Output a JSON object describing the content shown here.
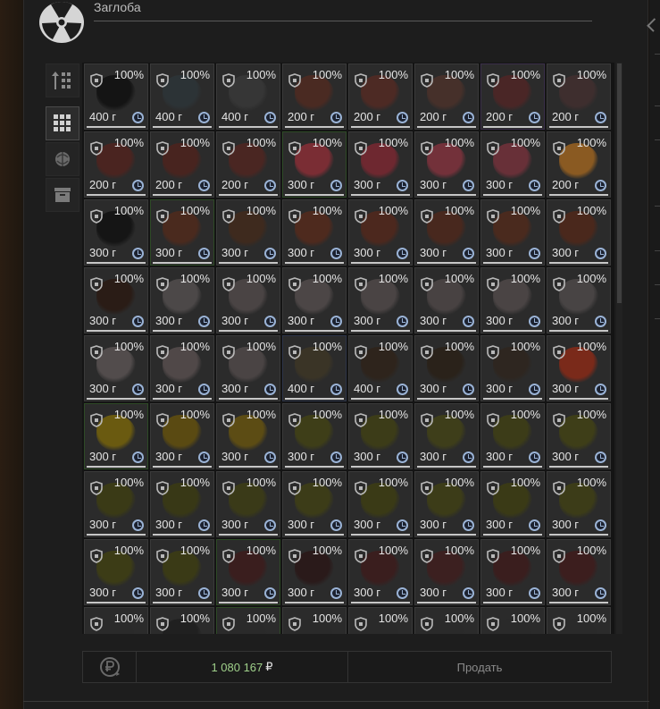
{
  "header": {
    "title": "Заглоба",
    "icon": "radiation-icon"
  },
  "sidebar": {
    "items": [
      {
        "name": "sort-icon",
        "active": false
      },
      {
        "name": "grid-view-icon",
        "active": true
      },
      {
        "name": "artifact-icon",
        "active": false
      },
      {
        "name": "archive-icon",
        "active": false
      }
    ]
  },
  "grid": {
    "cells": [
      {
        "percent": "100%",
        "weight": "400 г",
        "art": "#141414",
        "border": ""
      },
      {
        "percent": "100%",
        "weight": "400 г",
        "art": "#2c3336",
        "border": ""
      },
      {
        "percent": "100%",
        "weight": "400 г",
        "art": "#363636",
        "border": ""
      },
      {
        "percent": "100%",
        "weight": "200 г",
        "art": "#4a2a22",
        "border": ""
      },
      {
        "percent": "100%",
        "weight": "200 г",
        "art": "#4d2a24",
        "border": ""
      },
      {
        "percent": "100%",
        "weight": "200 г",
        "art": "#46302a",
        "border": ""
      },
      {
        "percent": "100%",
        "weight": "200 г",
        "art": "#4a2626",
        "border": "c-purple"
      },
      {
        "percent": "100%",
        "weight": "200 г",
        "art": "#3e2e2e",
        "border": ""
      },
      {
        "percent": "100%",
        "weight": "200 г",
        "art": "#4a2420",
        "border": ""
      },
      {
        "percent": "100%",
        "weight": "200 г",
        "art": "#48241f",
        "border": ""
      },
      {
        "percent": "100%",
        "weight": "200 г",
        "art": "#4a2622",
        "border": ""
      },
      {
        "percent": "100%",
        "weight": "300 г",
        "art": "#7a2d34",
        "border": "c-green"
      },
      {
        "percent": "100%",
        "weight": "300 г",
        "art": "#6e2830",
        "border": ""
      },
      {
        "percent": "100%",
        "weight": "300 г",
        "art": "#73313a",
        "border": ""
      },
      {
        "percent": "100%",
        "weight": "300 г",
        "art": "#683038",
        "border": ""
      },
      {
        "percent": "100%",
        "weight": "200 г",
        "art": "#8a5a22",
        "border": ""
      },
      {
        "percent": "100%",
        "weight": "300 г",
        "art": "#151515",
        "border": ""
      },
      {
        "percent": "100%",
        "weight": "300 г",
        "art": "#4a2a1e",
        "border": "c-green"
      },
      {
        "percent": "100%",
        "weight": "300 г",
        "art": "#3e2a1e",
        "border": ""
      },
      {
        "percent": "100%",
        "weight": "300 г",
        "art": "#4e2a1e",
        "border": ""
      },
      {
        "percent": "100%",
        "weight": "300 г",
        "art": "#4c281e",
        "border": ""
      },
      {
        "percent": "100%",
        "weight": "300 г",
        "art": "#48281e",
        "border": ""
      },
      {
        "percent": "100%",
        "weight": "300 г",
        "art": "#4a2a1e",
        "border": ""
      },
      {
        "percent": "100%",
        "weight": "300 г",
        "art": "#4a281c",
        "border": ""
      },
      {
        "percent": "100%",
        "weight": "300 г",
        "art": "#2a1c16",
        "border": ""
      },
      {
        "percent": "100%",
        "weight": "300 г",
        "art": "#4c4848",
        "border": ""
      },
      {
        "percent": "100%",
        "weight": "300 г",
        "art": "#4a4444",
        "border": ""
      },
      {
        "percent": "100%",
        "weight": "300 г",
        "art": "#4c4646",
        "border": ""
      },
      {
        "percent": "100%",
        "weight": "300 г",
        "art": "#4a4444",
        "border": ""
      },
      {
        "percent": "100%",
        "weight": "300 г",
        "art": "#484242",
        "border": ""
      },
      {
        "percent": "100%",
        "weight": "300 г",
        "art": "#4a4444",
        "border": ""
      },
      {
        "percent": "100%",
        "weight": "300 г",
        "art": "#484444",
        "border": ""
      },
      {
        "percent": "100%",
        "weight": "300 г",
        "art": "#524c4c",
        "border": ""
      },
      {
        "percent": "100%",
        "weight": "300 г",
        "art": "#504848",
        "border": ""
      },
      {
        "percent": "100%",
        "weight": "300 г",
        "art": "#4a4444",
        "border": ""
      },
      {
        "percent": "100%",
        "weight": "400 г",
        "art": "#3a3426",
        "border": "c-blue"
      },
      {
        "percent": "100%",
        "weight": "400 г",
        "art": "#2e241c",
        "border": ""
      },
      {
        "percent": "100%",
        "weight": "300 г",
        "art": "#2a221a",
        "border": ""
      },
      {
        "percent": "100%",
        "weight": "300 г",
        "art": "#2e2620",
        "border": ""
      },
      {
        "percent": "100%",
        "weight": "300 г",
        "art": "#7a2a1a",
        "border": ""
      },
      {
        "percent": "100%",
        "weight": "300 г",
        "art": "#6a5a10",
        "border": "c-green"
      },
      {
        "percent": "100%",
        "weight": "300 г",
        "art": "#5a4a12",
        "border": ""
      },
      {
        "percent": "100%",
        "weight": "300 г",
        "art": "#5c4c14",
        "border": ""
      },
      {
        "percent": "100%",
        "weight": "300 г",
        "art": "#3e3e18",
        "border": ""
      },
      {
        "percent": "100%",
        "weight": "300 г",
        "art": "#3c3c18",
        "border": ""
      },
      {
        "percent": "100%",
        "weight": "300 г",
        "art": "#3e3e1a",
        "border": ""
      },
      {
        "percent": "100%",
        "weight": "300 г",
        "art": "#3c3c18",
        "border": ""
      },
      {
        "percent": "100%",
        "weight": "300 г",
        "art": "#3e3e18",
        "border": ""
      },
      {
        "percent": "100%",
        "weight": "300 г",
        "art": "#3a3a16",
        "border": ""
      },
      {
        "percent": "100%",
        "weight": "300 г",
        "art": "#383816",
        "border": ""
      },
      {
        "percent": "100%",
        "weight": "300 г",
        "art": "#3a3a18",
        "border": ""
      },
      {
        "percent": "100%",
        "weight": "300 г",
        "art": "#3c3c18",
        "border": ""
      },
      {
        "percent": "100%",
        "weight": "300 г",
        "art": "#3a3a16",
        "border": ""
      },
      {
        "percent": "100%",
        "weight": "300 г",
        "art": "#3c3c18",
        "border": ""
      },
      {
        "percent": "100%",
        "weight": "300 г",
        "art": "#3a3a16",
        "border": ""
      },
      {
        "percent": "100%",
        "weight": "300 г",
        "art": "#3c3c18",
        "border": ""
      },
      {
        "percent": "100%",
        "weight": "300 г",
        "art": "#3c3c16",
        "border": ""
      },
      {
        "percent": "100%",
        "weight": "300 г",
        "art": "#3a3a16",
        "border": ""
      },
      {
        "percent": "100%",
        "weight": "300 г",
        "art": "#3a1e1e",
        "border": "c-green"
      },
      {
        "percent": "100%",
        "weight": "300 г",
        "art": "#2a1a1a",
        "border": ""
      },
      {
        "percent": "100%",
        "weight": "300 г",
        "art": "#3a1e1e",
        "border": ""
      },
      {
        "percent": "100%",
        "weight": "300 г",
        "art": "#3c2020",
        "border": ""
      },
      {
        "percent": "100%",
        "weight": "300 г",
        "art": "#3a1e1e",
        "border": ""
      },
      {
        "percent": "100%",
        "weight": "300 г",
        "art": "#3c1e1e",
        "border": ""
      },
      {
        "percent": "100%",
        "weight": "",
        "art": "#2a2a2a",
        "border": ""
      },
      {
        "percent": "100%",
        "weight": "",
        "art": "#202020",
        "border": ""
      },
      {
        "percent": "100%",
        "weight": "",
        "art": "#2a2a2a",
        "border": "c-green"
      },
      {
        "percent": "100%",
        "weight": "",
        "art": "#2a2a2a",
        "border": ""
      },
      {
        "percent": "100%",
        "weight": "",
        "art": "#2a2a2a",
        "border": ""
      },
      {
        "percent": "100%",
        "weight": "",
        "art": "#2a2a2a",
        "border": ""
      },
      {
        "percent": "100%",
        "weight": "",
        "art": "#2a2a2a",
        "border": ""
      },
      {
        "percent": "100%",
        "weight": "",
        "art": "#2a2a2a",
        "border": ""
      }
    ]
  },
  "footer": {
    "refresh_icon": "ruble-refresh-icon",
    "total_amount": "1 080 167",
    "currency": "₽",
    "sell_label": "Продать"
  },
  "colors": {
    "total": "#9fd08a",
    "clock": "#9ab3d6"
  }
}
